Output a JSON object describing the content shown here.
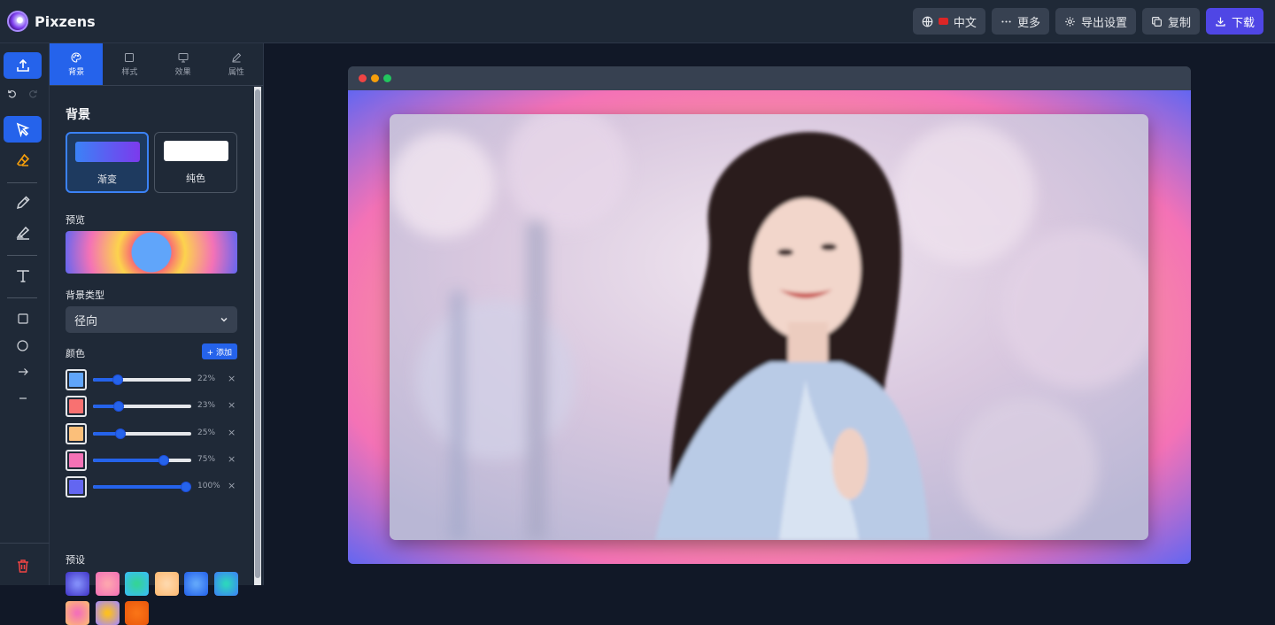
{
  "app": {
    "name": "Pixzens"
  },
  "header": {
    "language": "中文",
    "more": "更多",
    "export_settings": "导出设置",
    "copy": "复制",
    "download": "下载"
  },
  "tabs": [
    {
      "label": "背景",
      "icon": "palette-icon",
      "active": true
    },
    {
      "label": "样式",
      "icon": "square-icon",
      "active": false
    },
    {
      "label": "效果",
      "icon": "monitor-icon",
      "active": false
    },
    {
      "label": "属性",
      "icon": "pen-icon",
      "active": false
    }
  ],
  "panel": {
    "title": "背景",
    "bg_options": [
      {
        "label": "渐变",
        "selected": true
      },
      {
        "label": "纯色",
        "selected": false
      }
    ],
    "preview_label": "预览",
    "type_label": "背景类型",
    "type_value": "径向",
    "color_label": "颜色",
    "add_label": "+ 添加",
    "colors": [
      {
        "color": "#60a5fa",
        "pos": 22,
        "pct": "22%"
      },
      {
        "color": "#f87171",
        "pos": 23,
        "pct": "23%"
      },
      {
        "color": "#fbbf7a",
        "pos": 25,
        "pct": "25%"
      },
      {
        "color": "#f472b6",
        "pos": 75,
        "pct": "75%"
      },
      {
        "color": "#6366f1",
        "pos": 100,
        "pct": "100%"
      }
    ],
    "presets_label": "预设",
    "presets": [
      {
        "name": "indigo-radial",
        "from": "#818cf8",
        "to": "#4338ca"
      },
      {
        "name": "pink-radial",
        "from": "#fda4af",
        "to": "#f472b6"
      },
      {
        "name": "teal-radial",
        "from": "#34d399",
        "to": "#38bdf8"
      },
      {
        "name": "peach-radial",
        "from": "#fed7aa",
        "to": "#fdba74"
      },
      {
        "name": "blue-radial",
        "from": "#60a5fa",
        "to": "#2563eb"
      },
      {
        "name": "teal-blue-radial",
        "from": "#2dd4bf",
        "to": "#3b82f6"
      },
      {
        "name": "pink-orange-radial",
        "from": "#f472b6",
        "to": "#fdba74"
      },
      {
        "name": "rainbow-radial",
        "from": "#fbbf24",
        "to": "#a78bfa"
      },
      {
        "name": "orange-radial",
        "from": "#f97316",
        "to": "#ea580c"
      }
    ]
  },
  "colors": {
    "accent": "#2563eb",
    "download": "#4f46e5",
    "danger": "#ef4444"
  }
}
